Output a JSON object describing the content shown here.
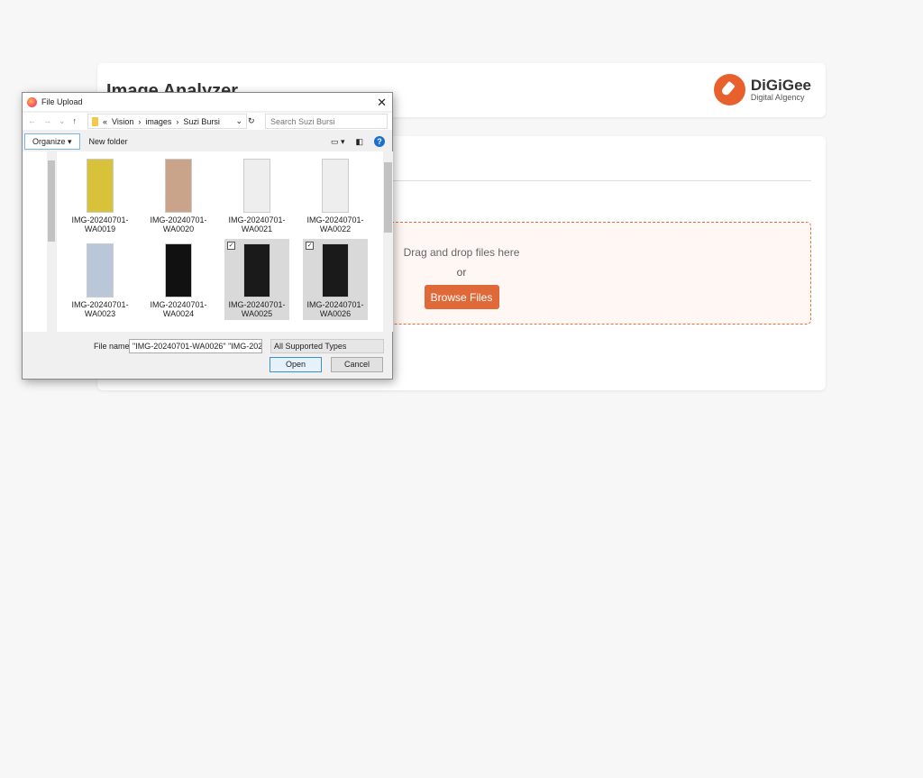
{
  "header": {
    "title": "Image Analyzer",
    "logo_name": "DiGiGee",
    "logo_tagline": "Digital AIgency"
  },
  "dropzone": {
    "prompt": "Drag and drop files here",
    "or": "or",
    "browse_label": "Browse Files"
  },
  "dialog": {
    "title": "File Upload",
    "breadcrumb": [
      "«",
      "Vision",
      "images",
      "Suzi Bursi"
    ],
    "search_placeholder": "Search Suzi Bursi",
    "organize_label": "Organize ▾",
    "new_folder_label": "New folder",
    "files": [
      {
        "name": "IMG-20240701-WA0019",
        "selected": false,
        "thumb": "#d8c23a"
      },
      {
        "name": "IMG-20240701-WA0020",
        "selected": false,
        "thumb": "#c9a48a"
      },
      {
        "name": "IMG-20240701-WA0021",
        "selected": false,
        "thumb": "#eeeeee"
      },
      {
        "name": "IMG-20240701-WA0022",
        "selected": false,
        "thumb": "#eeeeee"
      },
      {
        "name": "IMG-20240701-WA0023",
        "selected": false,
        "thumb": "#b9c7d9"
      },
      {
        "name": "IMG-20240701-WA0024",
        "selected": false,
        "thumb": "#111111"
      },
      {
        "name": "IMG-20240701-WA0025",
        "selected": true,
        "thumb": "#1a1a1a"
      },
      {
        "name": "IMG-20240701-WA0026",
        "selected": true,
        "thumb": "#1a1a1a"
      }
    ],
    "file_name_label": "File name:",
    "file_name_value": "\"IMG-20240701-WA0026\" \"IMG-2024",
    "file_type": "All Supported Types",
    "open_label": "Open",
    "cancel_label": "Cancel",
    "close_icon": "✕"
  },
  "colors": {
    "accent": "#e0693a"
  }
}
